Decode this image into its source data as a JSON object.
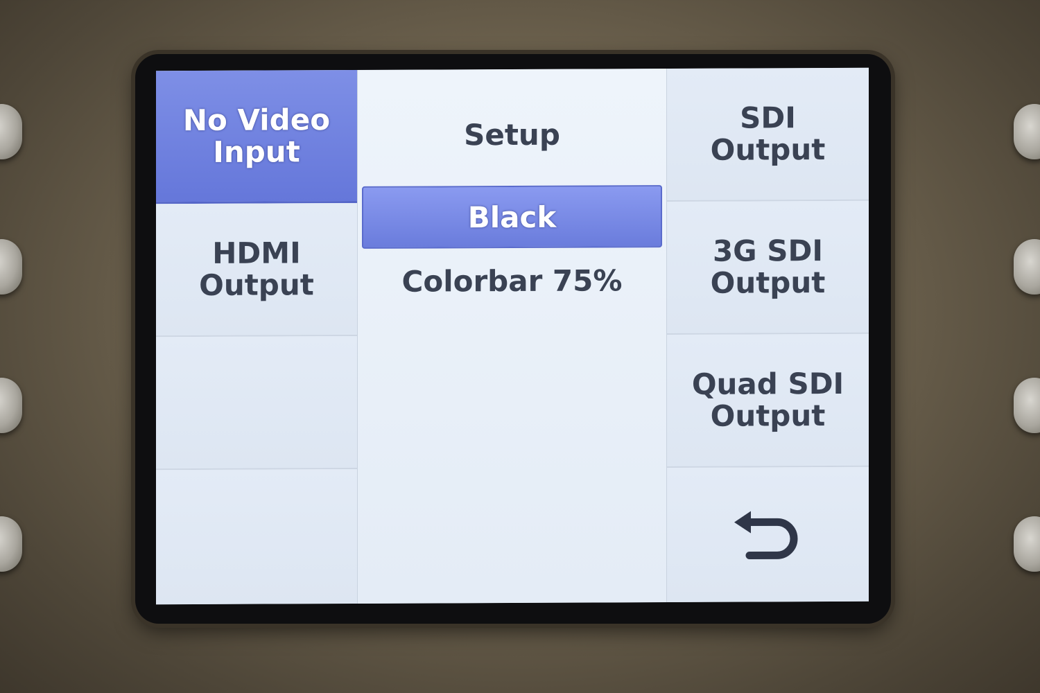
{
  "left_menu": [
    {
      "label": "No Video\nInput",
      "selected": true
    },
    {
      "label": "HDMI\nOutput",
      "selected": false
    },
    {
      "label": "",
      "selected": false
    },
    {
      "label": "",
      "selected": false
    }
  ],
  "middle": {
    "title": "Setup",
    "options": [
      "Black",
      "Colorbar 75%"
    ],
    "selected_option": "Black"
  },
  "right_menu": [
    {
      "label": "SDI\nOutput"
    },
    {
      "label": "3G SDI\nOutput"
    },
    {
      "label": "Quad SDI\nOutput"
    },
    {
      "icon": "back-arrow-icon"
    }
  ],
  "colors": {
    "accent": "#6a7cdc",
    "panel": "#e3ebf6",
    "text": "#3a4253"
  }
}
